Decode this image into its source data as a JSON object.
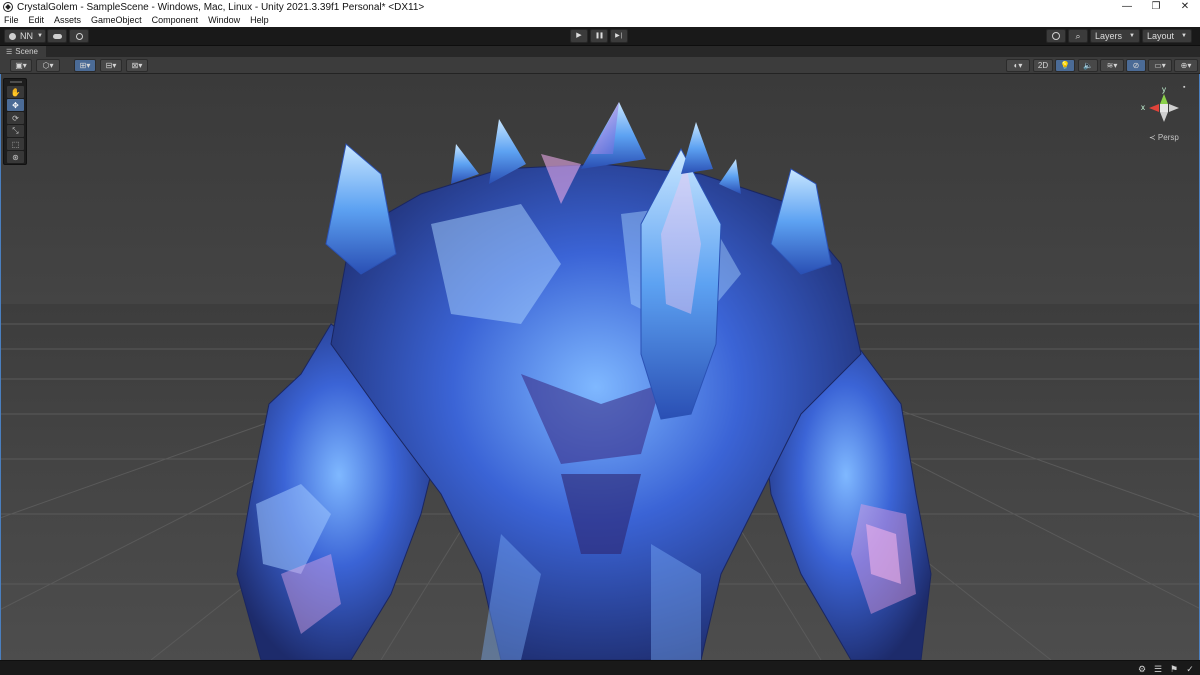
{
  "window": {
    "title": "CrystalGolem - SampleScene - Windows, Mac, Linux - Unity 2021.3.39f1 Personal* <DX11>",
    "controls": {
      "minimize": "—",
      "restore": "❐",
      "close": "✕"
    }
  },
  "menu": [
    "File",
    "Edit",
    "Assets",
    "GameObject",
    "Component",
    "Window",
    "Help"
  ],
  "toolbar": {
    "account_label": "NN",
    "layers_label": "Layers",
    "layout_label": "Layout",
    "play_icon": "▶",
    "pause_icon": "❚❚",
    "step_icon": "▶❘"
  },
  "tabs": {
    "scene_label": "Scene"
  },
  "scene_toolbar": {
    "mode_2d_label": "2D"
  },
  "gizmo": {
    "axis_x": "x",
    "axis_y": "y",
    "projection_label": "≺ Persp"
  },
  "colors": {
    "accent": "#4b6b96",
    "crystal_light": "#8fd1ff",
    "crystal_mid": "#3a6fd8",
    "crystal_dark": "#20306e",
    "crystal_pink": "#e79ad8",
    "gizmo_x": "#e0433a",
    "gizmo_y": "#8bd14a"
  }
}
